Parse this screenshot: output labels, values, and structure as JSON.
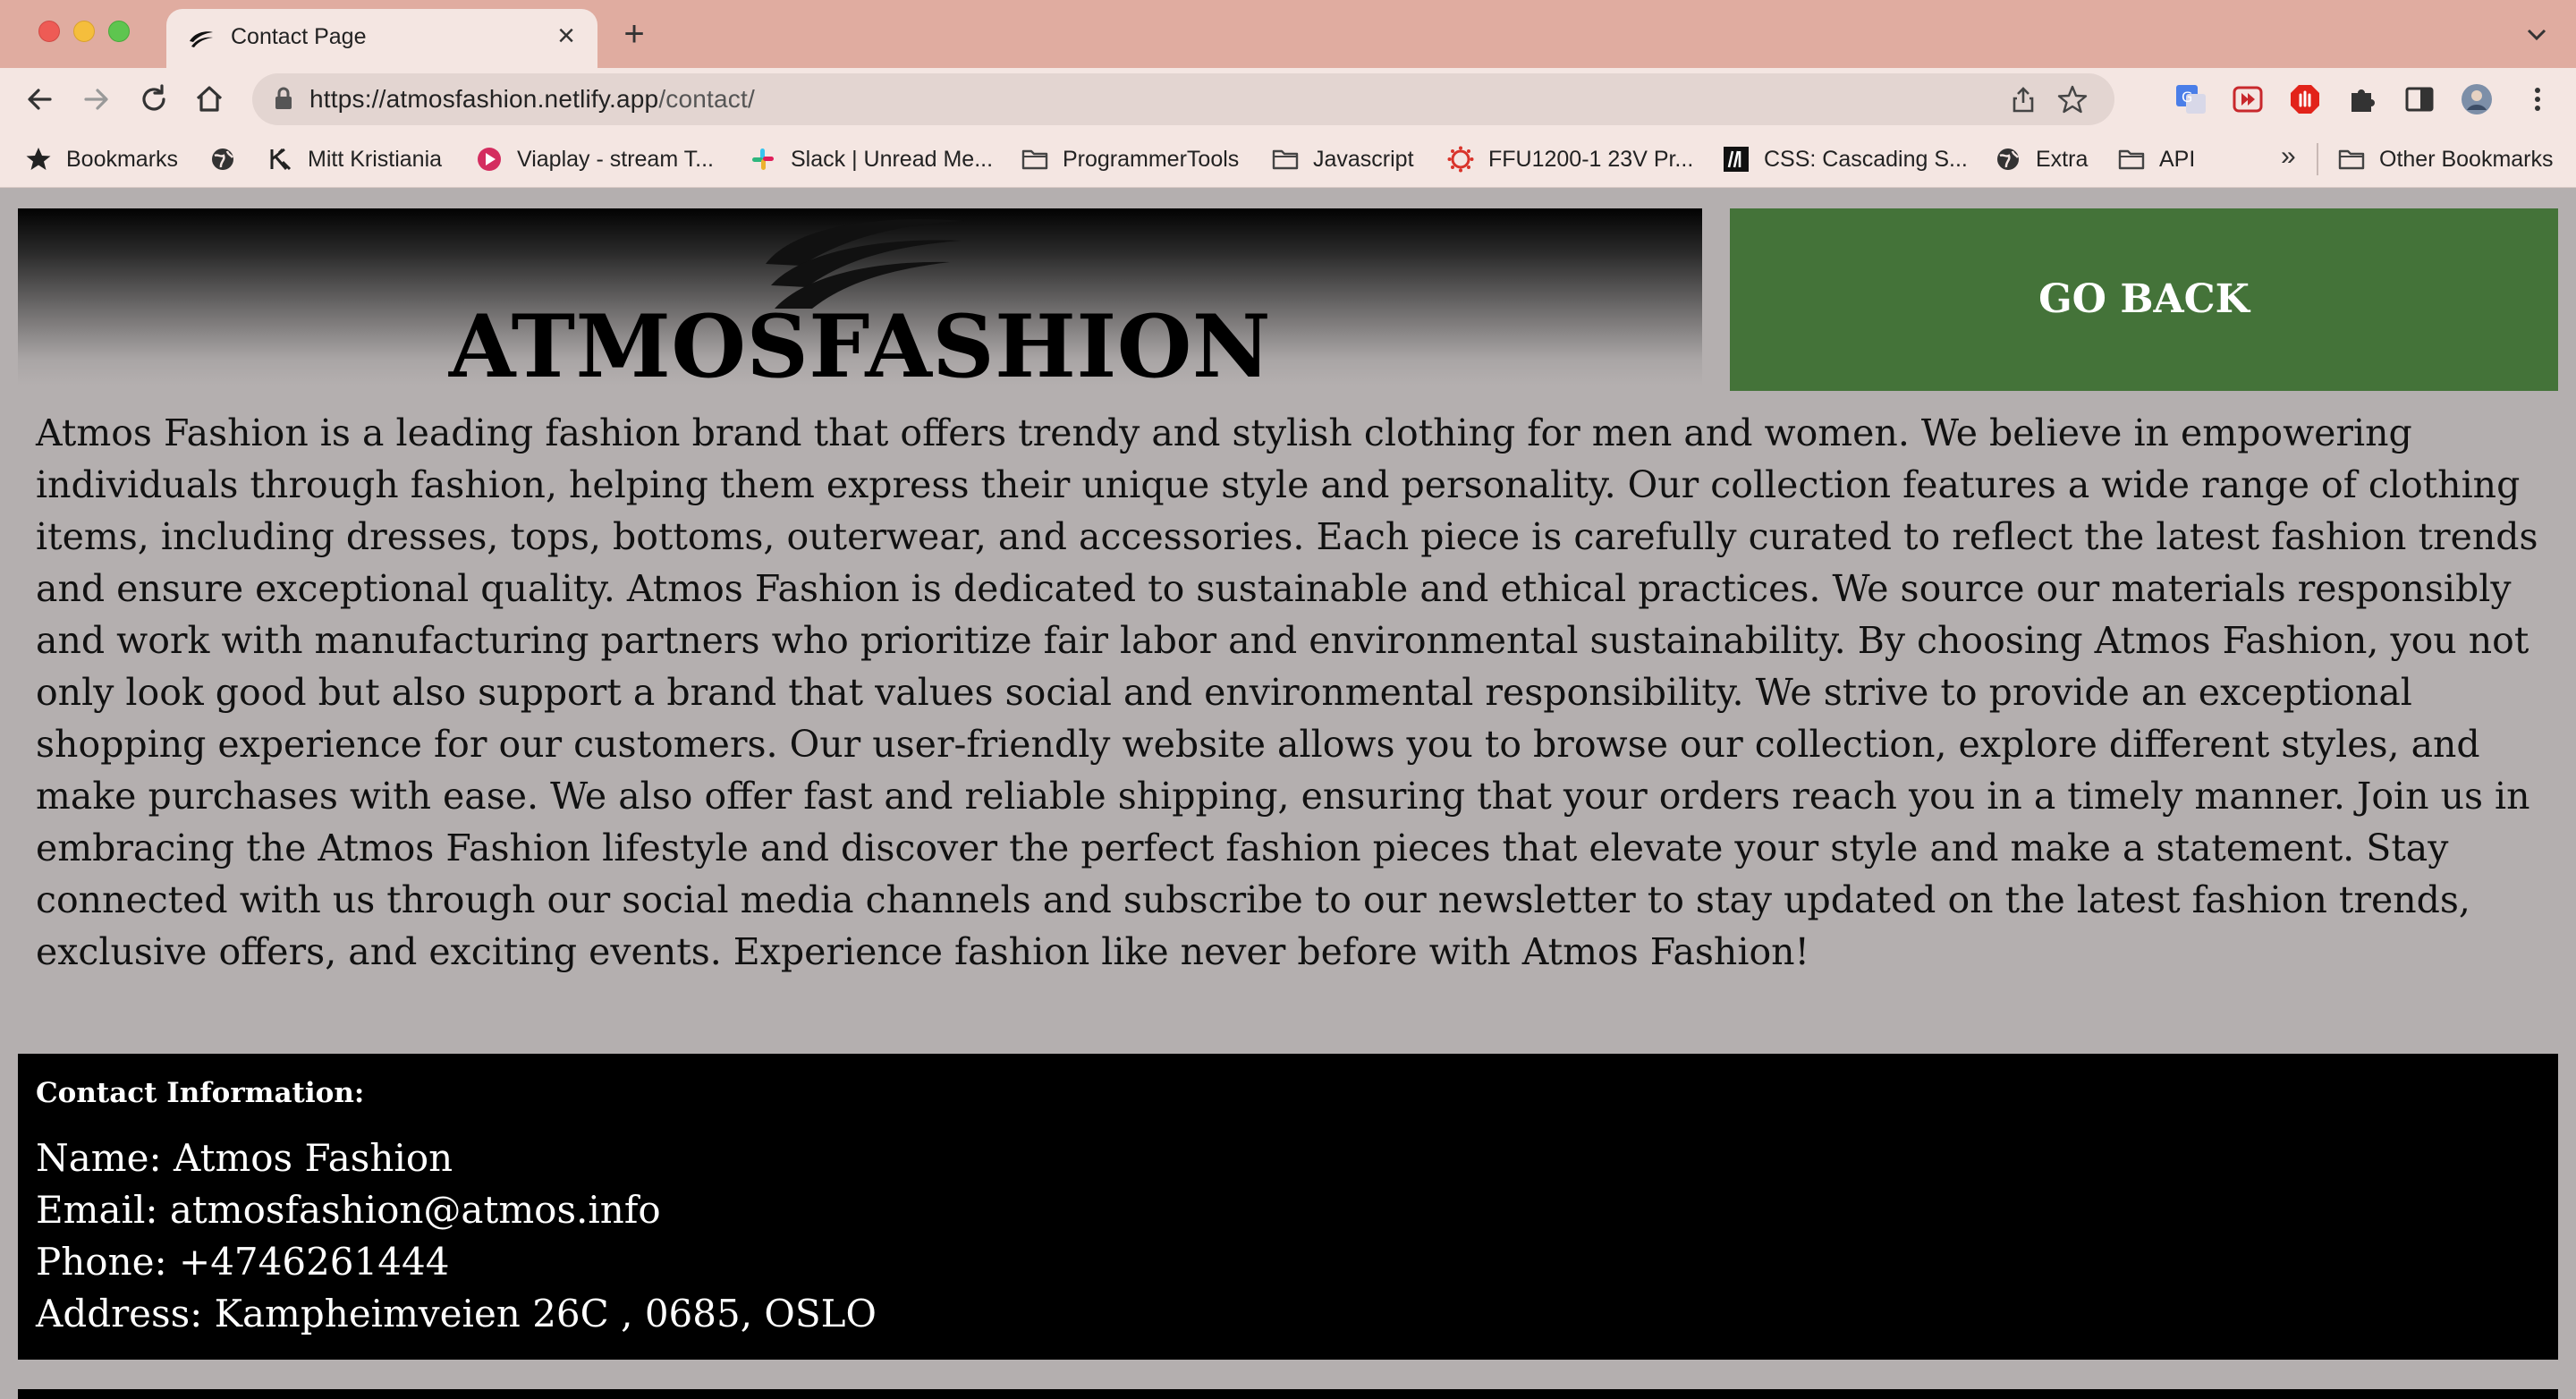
{
  "browser": {
    "tab_title": "Contact Page",
    "new_tab": "+",
    "url_host": "https://atmosfashion.netlify.app",
    "url_path": "/contact/",
    "bookmarks": [
      {
        "label": "Bookmarks",
        "icon": "star-icon"
      },
      {
        "label": "",
        "icon": "globe-icon"
      },
      {
        "label": "Mitt Kristiania",
        "icon": "kristiania-icon"
      },
      {
        "label": "Viaplay - stream T...",
        "icon": "viaplay-icon"
      },
      {
        "label": "Slack | Unread Me...",
        "icon": "slack-icon"
      },
      {
        "label": "ProgrammerTools",
        "icon": "folder-icon"
      },
      {
        "label": "Javascript",
        "icon": "folder-icon"
      },
      {
        "label": "FFU1200-1 23V Pr...",
        "icon": "canvas-icon"
      },
      {
        "label": "CSS: Cascading S...",
        "icon": "mdn-icon"
      },
      {
        "label": "Extra",
        "icon": "globe-icon"
      },
      {
        "label": "API",
        "icon": "folder-icon"
      }
    ],
    "bookmarks_overflow": "»",
    "other_bookmarks": "Other Bookmarks"
  },
  "page": {
    "brand": "ATMOSFASHION",
    "go_back": "GO BACK",
    "about": "Atmos Fashion is a leading fashion brand that offers trendy and stylish clothing for men and women. We believe in empowering individuals through fashion, helping them express their unique style and personality. Our collection features a wide range of clothing items, including dresses, tops, bottoms, outerwear, and accessories. Each piece is carefully curated to reflect the latest fashion trends and ensure exceptional quality. Atmos Fashion is dedicated to sustainable and ethical practices. We source our materials responsibly and work with manufacturing partners who prioritize fair labor and environmental sustainability. By choosing Atmos Fashion, you not only look good but also support a brand that values social and environmental responsibility. We strive to provide an exceptional shopping experience for our customers. Our user-friendly website allows you to browse our collection, explore different styles, and make purchases with ease. We also offer fast and reliable shipping, ensuring that your orders reach you in a timely manner. Join us in embracing the Atmos Fashion lifestyle and discover the perfect fashion pieces that elevate your style and make a statement. Stay connected with us through our social media channels and subscribe to our newsletter to stay updated on the latest fashion trends, exclusive offers, and exciting events. Experience fashion like never before with Atmos Fashion!",
    "contact": {
      "heading": "Contact Information:",
      "name": "Name: Atmos Fashion",
      "email": "Email: atmosfashion@atmos.info",
      "phone": "Phone: +4746261444",
      "address": "Address: Kampheimveien 26C , 0685, OSLO"
    }
  },
  "colors": {
    "titlebar": "#e0aca0",
    "toolbar": "#f4e6e2",
    "page_bg": "#b4afaf",
    "go_back_bg": "#447339",
    "contact_bg": "#000000"
  }
}
